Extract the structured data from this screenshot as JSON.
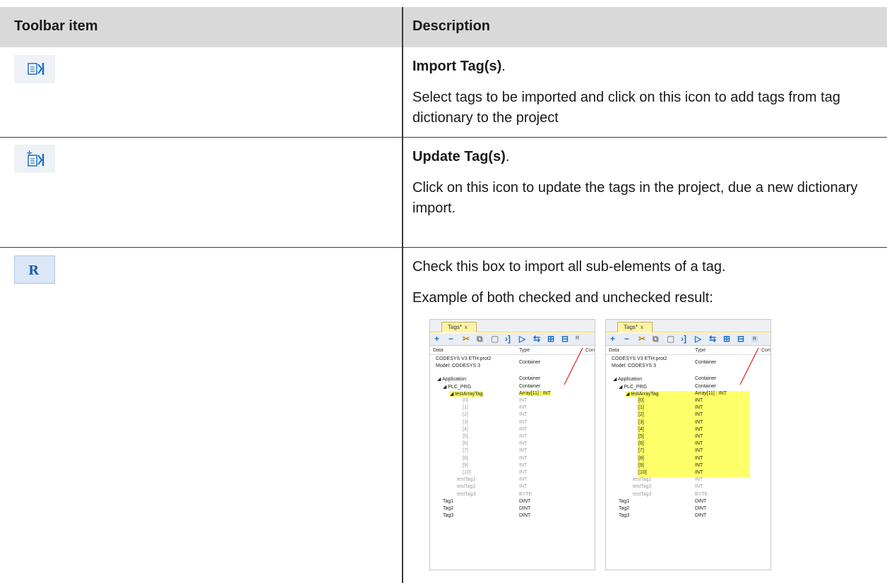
{
  "header": {
    "col1": "Toolbar item",
    "col2": "Description"
  },
  "rows": [
    {
      "icon": "import-tags-icon",
      "title": "Import Tag(s)",
      "title_suffix": ".",
      "text": "Select tags to be imported and click on this icon to add tags from tag dictionary to the project"
    },
    {
      "icon": "update-tags-icon",
      "title": "Update Tag(s)",
      "title_suffix": ".",
      "text": "Click on this icon to update the tags in the project, due a new dictionary import."
    },
    {
      "icon": "recursive-r-icon",
      "text": "Check this box to import all sub-elements of a tag.",
      "text2": "Example of both checked and unchecked result:"
    }
  ],
  "example": {
    "tab_label": "Tags*",
    "tab_close": "x",
    "col_data": "Data",
    "col_type": "Type",
    "col_con": "Con",
    "tree": [
      {
        "name": "CODESYS V3 ETH:prot2",
        "type": ""
      },
      {
        "name": "Model: CODESYS 3",
        "type": "Container"
      },
      {
        "name": "Application",
        "type": "Container"
      },
      {
        "name": "PLC_PRG",
        "type": "Container"
      },
      {
        "name": "testArrayTag",
        "type": "Array[11] : INT"
      },
      {
        "name": "[0]",
        "type": "INT"
      },
      {
        "name": "[1]",
        "type": "INT"
      },
      {
        "name": "[2]",
        "type": "INT"
      },
      {
        "name": "[3]",
        "type": "INT"
      },
      {
        "name": "[4]",
        "type": "INT"
      },
      {
        "name": "[5]",
        "type": "INT"
      },
      {
        "name": "[6]",
        "type": "INT"
      },
      {
        "name": "[7]",
        "type": "INT"
      },
      {
        "name": "[8]",
        "type": "INT"
      },
      {
        "name": "[9]",
        "type": "INT"
      },
      {
        "name": "[10]",
        "type": "INT"
      },
      {
        "name": "testTag1",
        "type": "INT"
      },
      {
        "name": "testTag2",
        "type": "INT"
      },
      {
        "name": "testTag3",
        "type": "BYTE"
      },
      {
        "name": "Tag1",
        "type": "DINT"
      },
      {
        "name": "Tag2",
        "type": "DINT"
      },
      {
        "name": "Tag3",
        "type": "DINT"
      }
    ]
  },
  "colors": {
    "header_bg": "#d9d9d9",
    "highlight": "#ffff5a",
    "icon_blue": "#1b6fc4",
    "arrow_red": "#e03030"
  }
}
